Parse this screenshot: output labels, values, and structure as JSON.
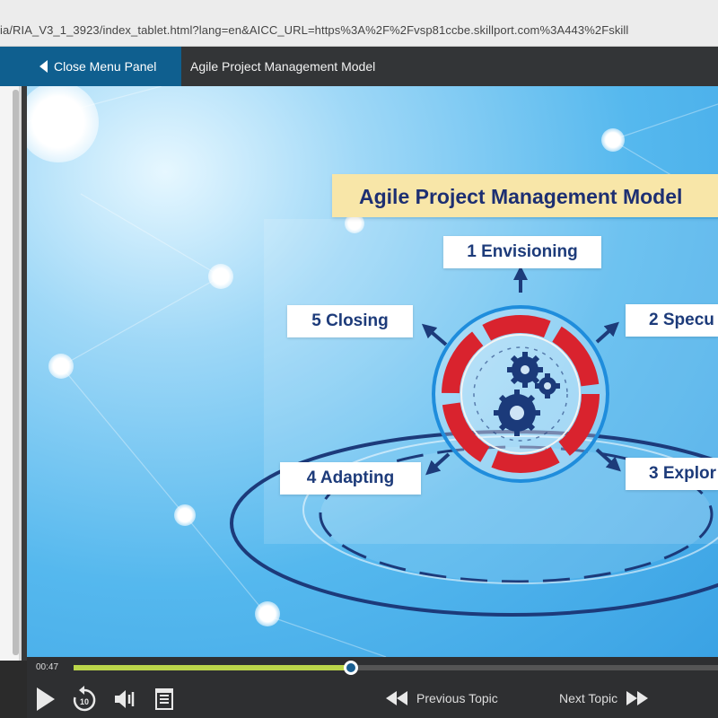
{
  "browser": {
    "url": "ia/RIA_V3_1_3923/index_tablet.html?lang=en&AICC_URL=https%3A%2F%2Fvsp81ccbe.skillport.com%3A443%2Fskill"
  },
  "header": {
    "close_menu_label": "Close Menu Panel",
    "title": "Agile Project Management Model"
  },
  "slide": {
    "banner_title": "Agile Project Management Model",
    "stages": [
      {
        "label": "1 Envisioning"
      },
      {
        "label": "2 Specu"
      },
      {
        "label": "3 Explor"
      },
      {
        "label": "4 Adapting"
      },
      {
        "label": "5 Closing"
      }
    ],
    "colors": {
      "ring_red": "#d9232e",
      "ring_blue": "#1f8ddc",
      "gear_navy": "#1b3a7a",
      "arrow_navy": "#1d3b7a"
    }
  },
  "player": {
    "time": "00:47",
    "progress": 0.43,
    "prev_label": "Previous Topic",
    "next_label": "Next Topic",
    "icons": [
      "play-icon",
      "replay-10-icon",
      "volume-icon",
      "transcript-icon",
      "rewind-icon",
      "fast-forward-icon"
    ],
    "accent": "#bcd64a"
  }
}
